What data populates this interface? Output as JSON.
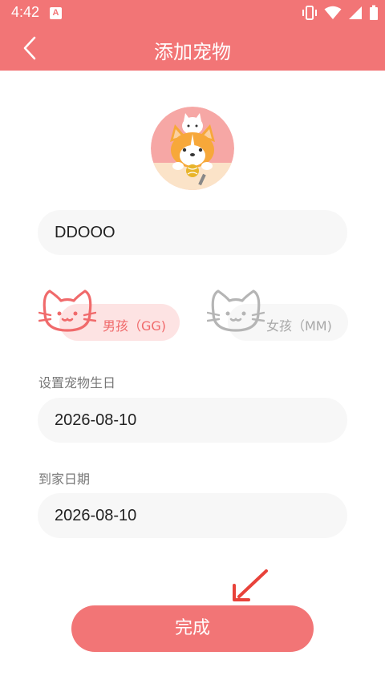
{
  "status_bar": {
    "time": "4:42",
    "app_icon_letter": "A"
  },
  "header": {
    "title": "添加宠物"
  },
  "pet_form": {
    "name_value": "DDOOO",
    "gender": {
      "boy_label": "男孩（GG)",
      "girl_label": "女孩（MM)",
      "selected": "boy"
    },
    "birthday_label": "设置宠物生日",
    "birthday_value": "2026-08-10",
    "arrival_label": "到家日期",
    "arrival_value": "2026-08-10"
  },
  "done_button": {
    "label": "完成"
  },
  "icons": [
    "back-arrow-icon",
    "vibrate-icon",
    "wifi-icon",
    "cellular-signal-icon",
    "battery-icon",
    "cat-icon",
    "arrow-pointer-icon"
  ],
  "colors": {
    "accent": "#f27576",
    "selected_pill": "#fde3e3",
    "field_background": "#f7f7f7",
    "inactive": "#b5b5b5",
    "arrow_hint": "#e8423a"
  }
}
